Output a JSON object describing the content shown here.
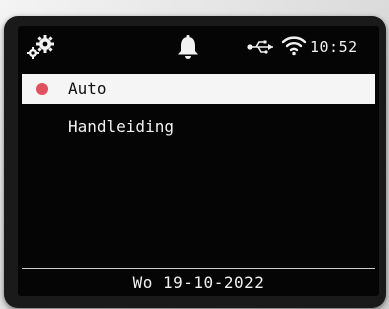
{
  "status_bar": {
    "icons": [
      "gear-icon",
      "bell-icon",
      "usb-icon",
      "wifi-icon"
    ],
    "time": "10:52"
  },
  "menu": {
    "items": [
      {
        "label": "Auto",
        "selected": true,
        "indicator_color": "#e0505f"
      },
      {
        "label": "Handleiding",
        "selected": false
      }
    ]
  },
  "footer": {
    "date": "Wo 19-10-2022"
  },
  "colors": {
    "screen_background": "#050505",
    "highlight": "#f5f5f5",
    "text": "#f2f2f2"
  }
}
